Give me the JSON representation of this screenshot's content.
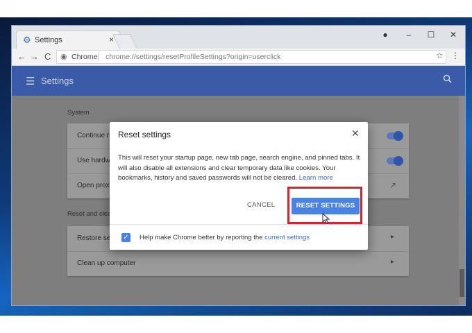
{
  "tab": {
    "title": "Settings",
    "close": "×"
  },
  "window_controls": {
    "account": "●",
    "minimize": "–",
    "maximize": "☐",
    "close": "✕"
  },
  "toolbar": {
    "back": "←",
    "forward": "→",
    "reload": "C",
    "site_name": "Chrome",
    "separator": "|",
    "url": "chrome://settings/resetProfileSettings?origin=userclick",
    "star": "☆",
    "menu": "⋮"
  },
  "header": {
    "menu_icon": "☰",
    "title": "Settings",
    "search_icon": "🔍"
  },
  "system": {
    "label": "System",
    "rows": [
      "Continue r",
      "Use hardw",
      "Open proxy"
    ]
  },
  "reset_section": {
    "label": "Reset and clea",
    "rows": [
      "Restore set",
      "Clean up computer"
    ]
  },
  "dialog": {
    "title": "Reset settings",
    "close": "✕",
    "body": "This will reset your startup page, new tab page, search engine, and pinned tabs. It will also disable all extensions and clear temporary data like cookies. Your bookmarks, history and saved passwords will not be cleared.",
    "learn_more": "Learn more",
    "cancel": "CANCEL",
    "reset": "RESET SETTINGS",
    "footer_text": "Help make Chrome better by reporting the",
    "footer_link": "current settings",
    "checkbox_checked": true
  },
  "colors": {
    "header_bg": "#3b5aa8",
    "primary_button": "#4a82e4",
    "highlight_border": "#d52331",
    "link": "#3b6bd1"
  }
}
